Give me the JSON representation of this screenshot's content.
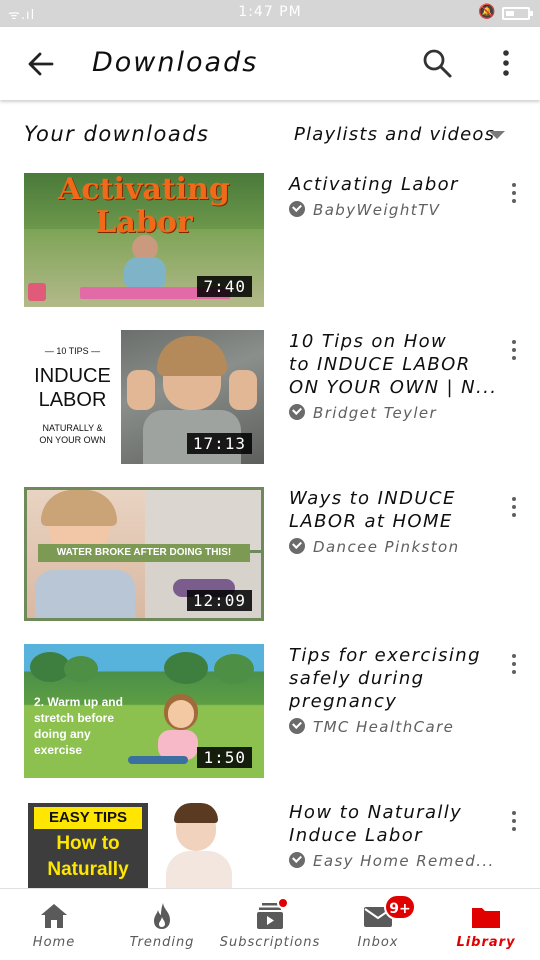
{
  "status_bar": {
    "signal": "ᯤ.ıl",
    "time": "1:47 PM"
  },
  "app_bar": {
    "title": "Downloads"
  },
  "section": {
    "left": "Your downloads",
    "right": "Playlists and videos"
  },
  "videos": [
    {
      "title_lines": [
        "Activating Labor"
      ],
      "channel": "BabyWeightTV",
      "duration": "7:40",
      "thumb_text": [
        "Activating",
        "Labor"
      ]
    },
    {
      "title_lines": [
        "10 Tips on How",
        "to INDUCE LABOR",
        "ON YOUR OWN | N..."
      ],
      "channel": "Bridget Teyler",
      "duration": "17:13",
      "thumb_text": [
        "— 10 TIPS —",
        "INDUCE",
        "LABOR",
        "NATURALLY &",
        "ON YOUR OWN"
      ]
    },
    {
      "title_lines": [
        "Ways to INDUCE",
        "LABOR at HOME"
      ],
      "channel": "Dancee Pinkston",
      "duration": "12:09",
      "thumb_text": [
        "WATER BROKE AFTER DOING THIS!"
      ]
    },
    {
      "title_lines": [
        "Tips for exercising",
        "safely during",
        "pregnancy"
      ],
      "channel": "TMC HealthCare",
      "duration": "1:50",
      "thumb_text": [
        "2. Warm up and",
        "stretch before",
        "doing any",
        "exercise"
      ]
    },
    {
      "title_lines": [
        "How to Naturally",
        "Induce Labor"
      ],
      "channel": "Easy Home Remed...",
      "duration": "",
      "thumb_text": [
        "EASY TIPS",
        "How to",
        "Naturally"
      ]
    }
  ],
  "bottom_nav": [
    {
      "label": "Home"
    },
    {
      "label": "Trending"
    },
    {
      "label": "Subscriptions"
    },
    {
      "label": "Inbox"
    },
    {
      "label": "Library"
    }
  ],
  "inbox_badge": "9+",
  "colors": {
    "accent": "#e00000",
    "text": "#0f0f0f",
    "muted": "#606060"
  }
}
